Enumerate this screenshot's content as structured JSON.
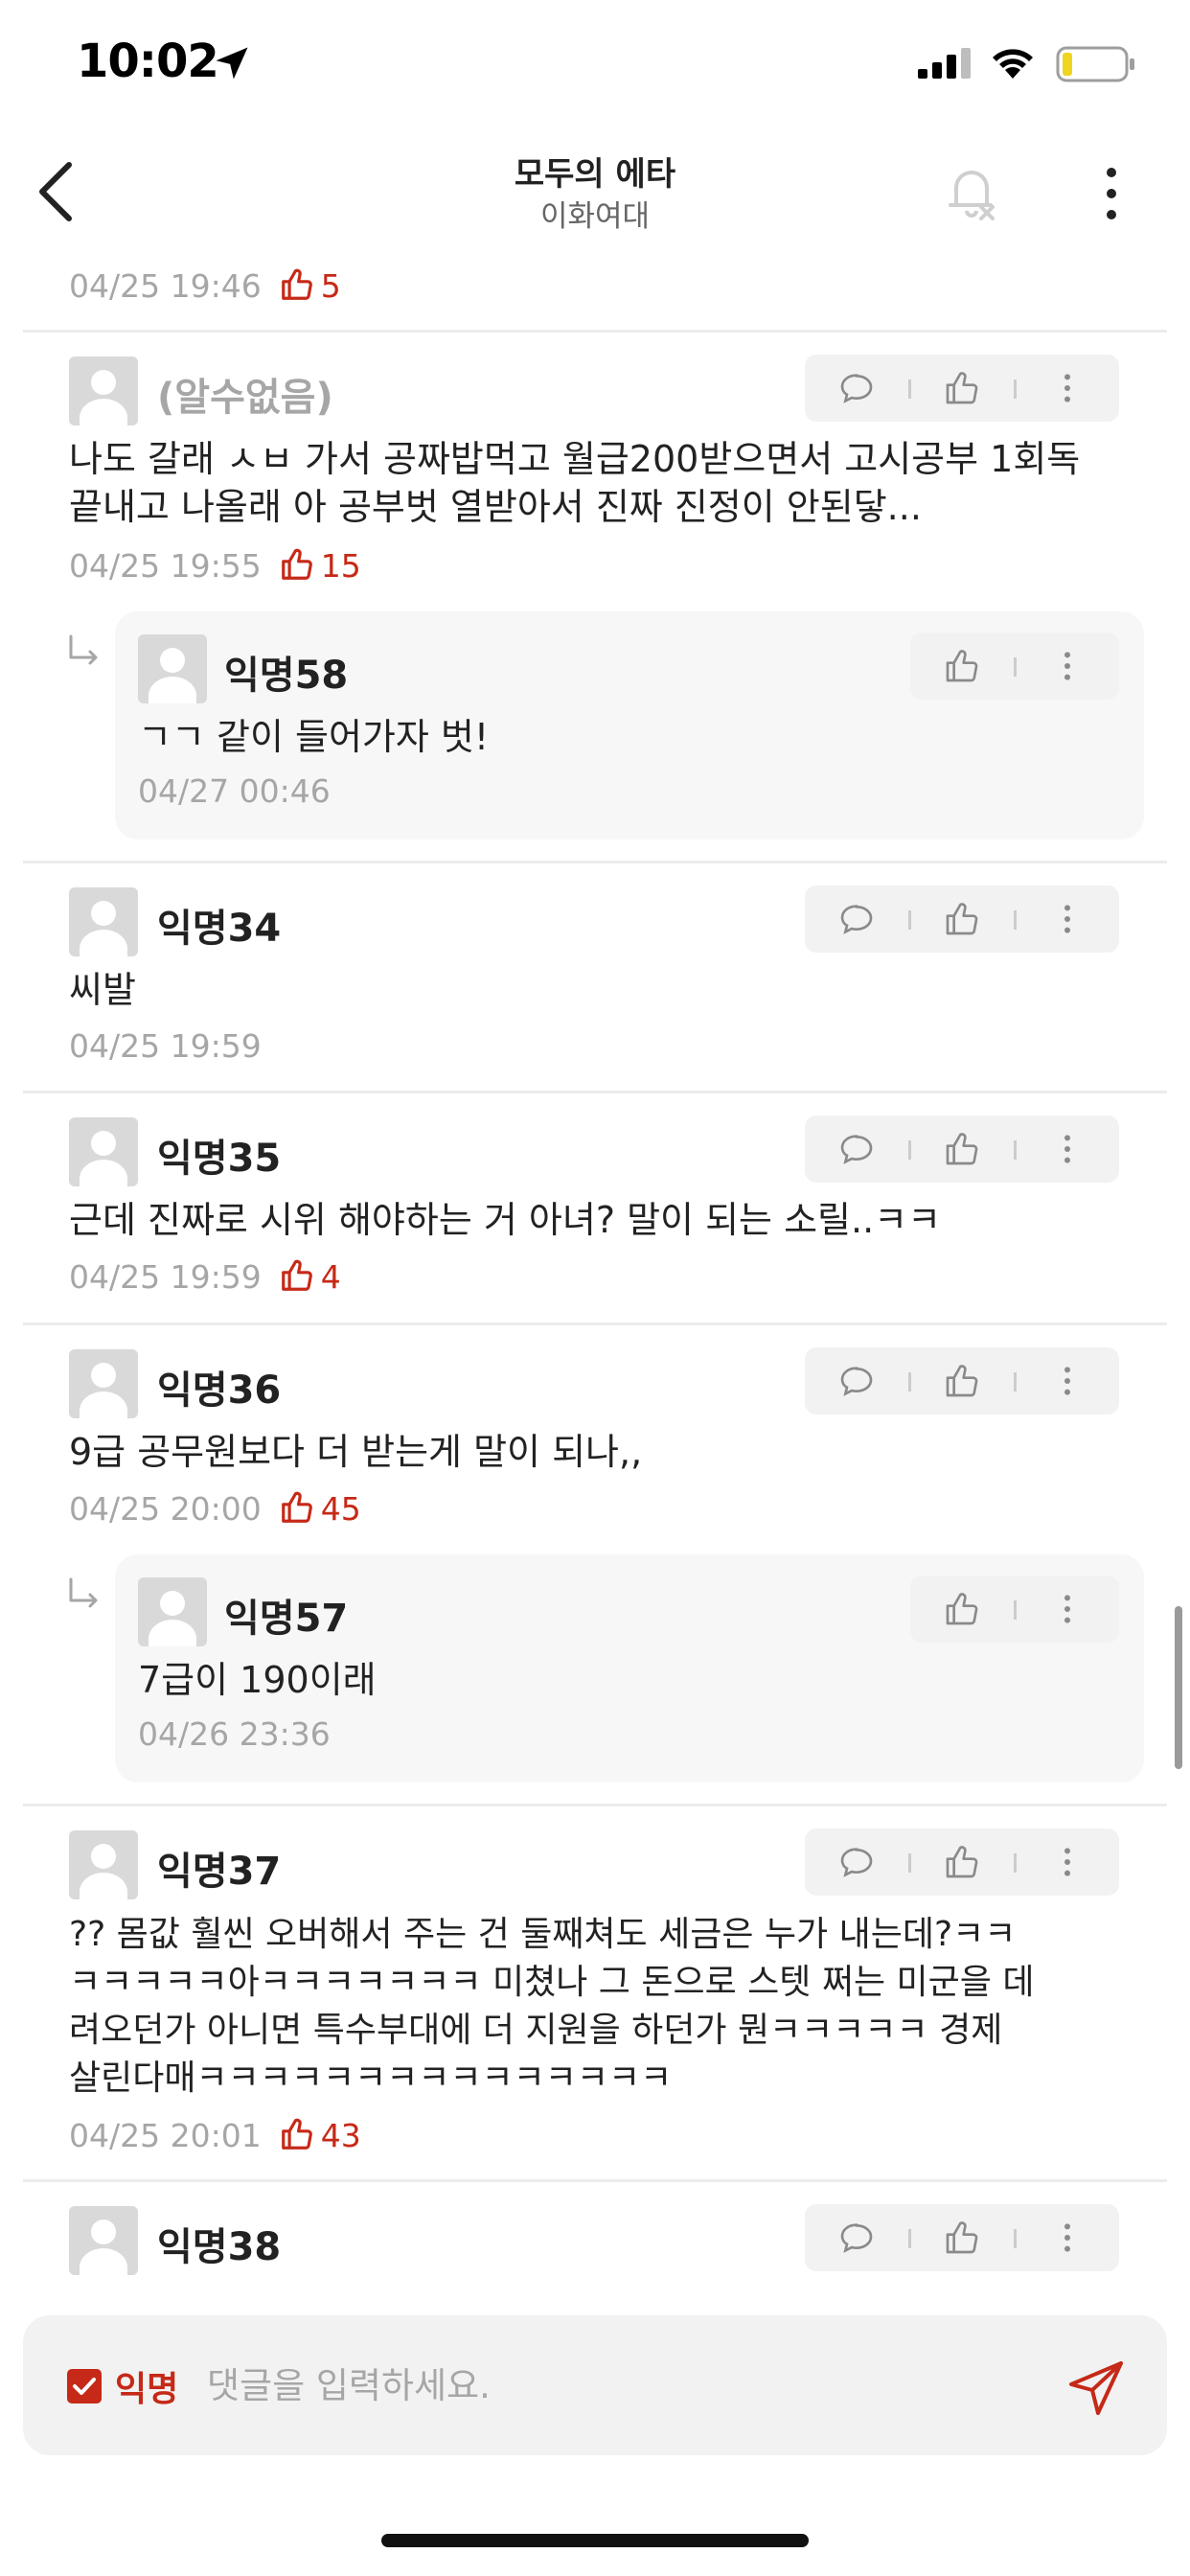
{
  "status_bar": {
    "time": "10:02"
  },
  "header": {
    "title": "모두의 에타",
    "subtitle": "이화여대"
  },
  "top_meta": {
    "date": "04/25 19:46",
    "likes": "5"
  },
  "comments": [
    {
      "author": "(알수없음)",
      "text": "나도 갈래 ㅅㅂ 가서 공짜밥먹고 월급200받으면서 고시공부 1회독\n끝내고 나올래 아 공부벗 열받아서 진짜 진정이 안된닿...",
      "date": "04/25 19:55",
      "likes": "15",
      "replies": [
        {
          "author": "익명58",
          "text": "ㄱㄱ 같이 들어가자 벗!",
          "date": "04/27 00:46"
        }
      ]
    },
    {
      "author": "익명34",
      "text": "씨발",
      "date": "04/25 19:59",
      "likes": ""
    },
    {
      "author": "익명35",
      "text": "근데 진짜로 시위 해야하는 거 아녀? 말이 되는 소릴..ㅋㅋ",
      "date": "04/25 19:59",
      "likes": "4"
    },
    {
      "author": "익명36",
      "text": "9급 공무원보다 더 받는게 말이 되나,,",
      "date": "04/25 20:00",
      "likes": "45",
      "replies": [
        {
          "author": "익명57",
          "text": "7급이 190이래",
          "date": "04/26 23:36"
        }
      ]
    },
    {
      "author": "익명37",
      "text": "?? 몸값 훨씬 오버해서 주는 건 둘째쳐도 세금은 누가 내는데?ㅋㅋ\nㅋㅋㅋㅋㅋ아ㅋㅋㅋㅋㅋㅋㅋ 미쳤나 그 돈으로 스텟 쩌는 미군을 데\n려오던가 아니면 특수부대에 더 지원을 하던가 뭔ㅋㅋㅋㅋㅋ 경제\n살린다매ㅋㅋㅋㅋㅋㅋㅋㅋㅋㅋㅋㅋㅋㅋㅋ",
      "date": "04/25 20:01",
      "likes": "43"
    },
    {
      "author": "익명38",
      "text": "",
      "date": "",
      "likes": ""
    }
  ],
  "composer": {
    "anon_label": "익명",
    "placeholder": "댓글을 입력하세요."
  },
  "colors": {
    "accent": "#c62917",
    "muted": "#a6a6a6",
    "action_bg": "#f2f2f2",
    "reply_bg": "#f7f7f7"
  }
}
